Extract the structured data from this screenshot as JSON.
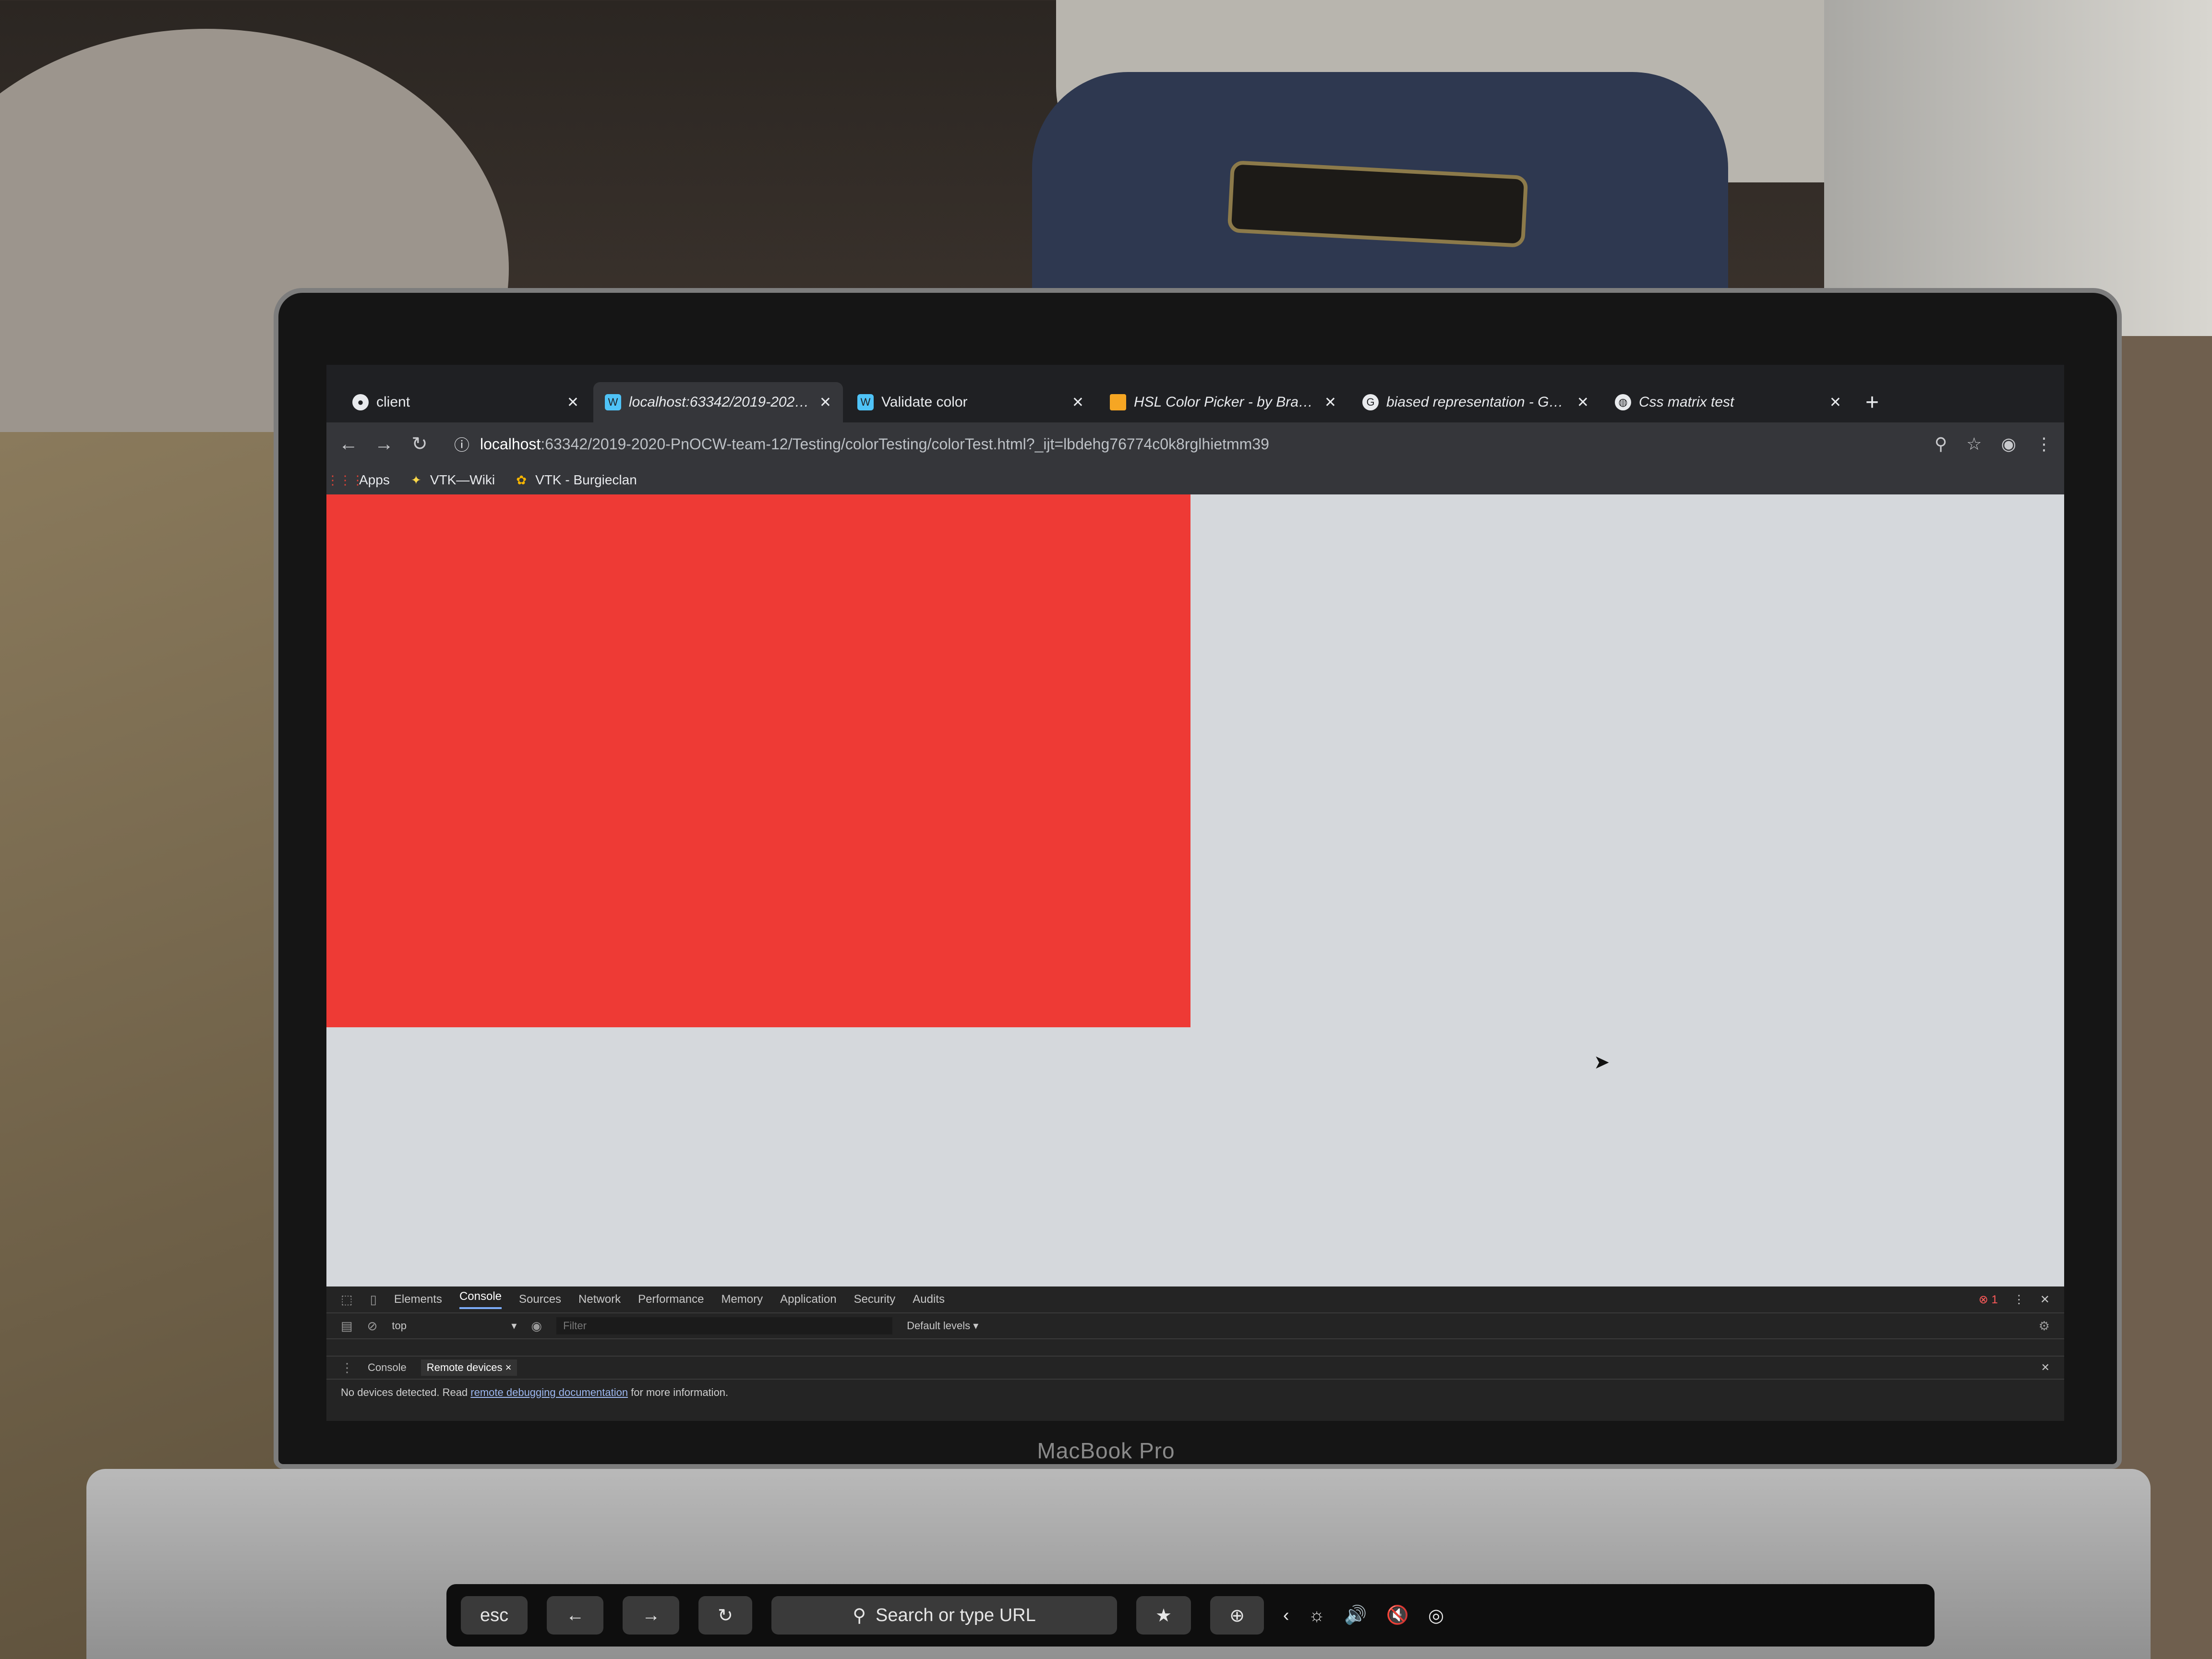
{
  "colors": {
    "accent_red": "#ee3a35",
    "page_bg": "#d5d8dc",
    "chrome_dark": "#202124"
  },
  "browser": {
    "tabs": [
      {
        "label": "client",
        "icon": "github-icon",
        "active": false
      },
      {
        "label": "localhost:63342/2019-2020-Pn",
        "icon": "webstorm-icon",
        "active": true
      },
      {
        "label": "Validate color",
        "icon": "webstorm-icon",
        "active": false
      },
      {
        "label": "HSL Color Picker - by Brandon I",
        "icon": "colorpicker-icon",
        "active": false
      },
      {
        "label": "biased representation - Google",
        "icon": "google-icon",
        "active": false
      },
      {
        "label": "Css matrix test",
        "icon": "globe-icon",
        "active": false
      }
    ],
    "url_host": "localhost",
    "url_path": ":63342/2019-2020-PnOCW-team-12/Testing/colorTesting/colorTest.html?_ijt=lbdehg76774c0k8rglhietmm39",
    "bookmarks": [
      {
        "label": "Apps",
        "icon": "apps-grid-icon"
      },
      {
        "label": "VTK—Wiki",
        "icon": "vtk-icon"
      },
      {
        "label": "VTK - Burgieclan",
        "icon": "burgieclan-icon"
      }
    ]
  },
  "devtools": {
    "tabs": [
      "Elements",
      "Console",
      "Sources",
      "Network",
      "Performance",
      "Memory",
      "Application",
      "Security",
      "Audits"
    ],
    "active_tab": "Console",
    "error_count": "1",
    "context": "top",
    "filter_placeholder": "Filter",
    "levels": "Default levels ▾",
    "drawer_tabs": [
      "Console",
      "Remote devices"
    ],
    "message_prefix": "No devices detected. Read ",
    "message_link": "remote debugging documentation",
    "message_suffix": " for more information."
  },
  "laptop": {
    "brand": "MacBook Pro",
    "touchbar": {
      "esc": "esc",
      "search": "Search or type URL"
    }
  }
}
